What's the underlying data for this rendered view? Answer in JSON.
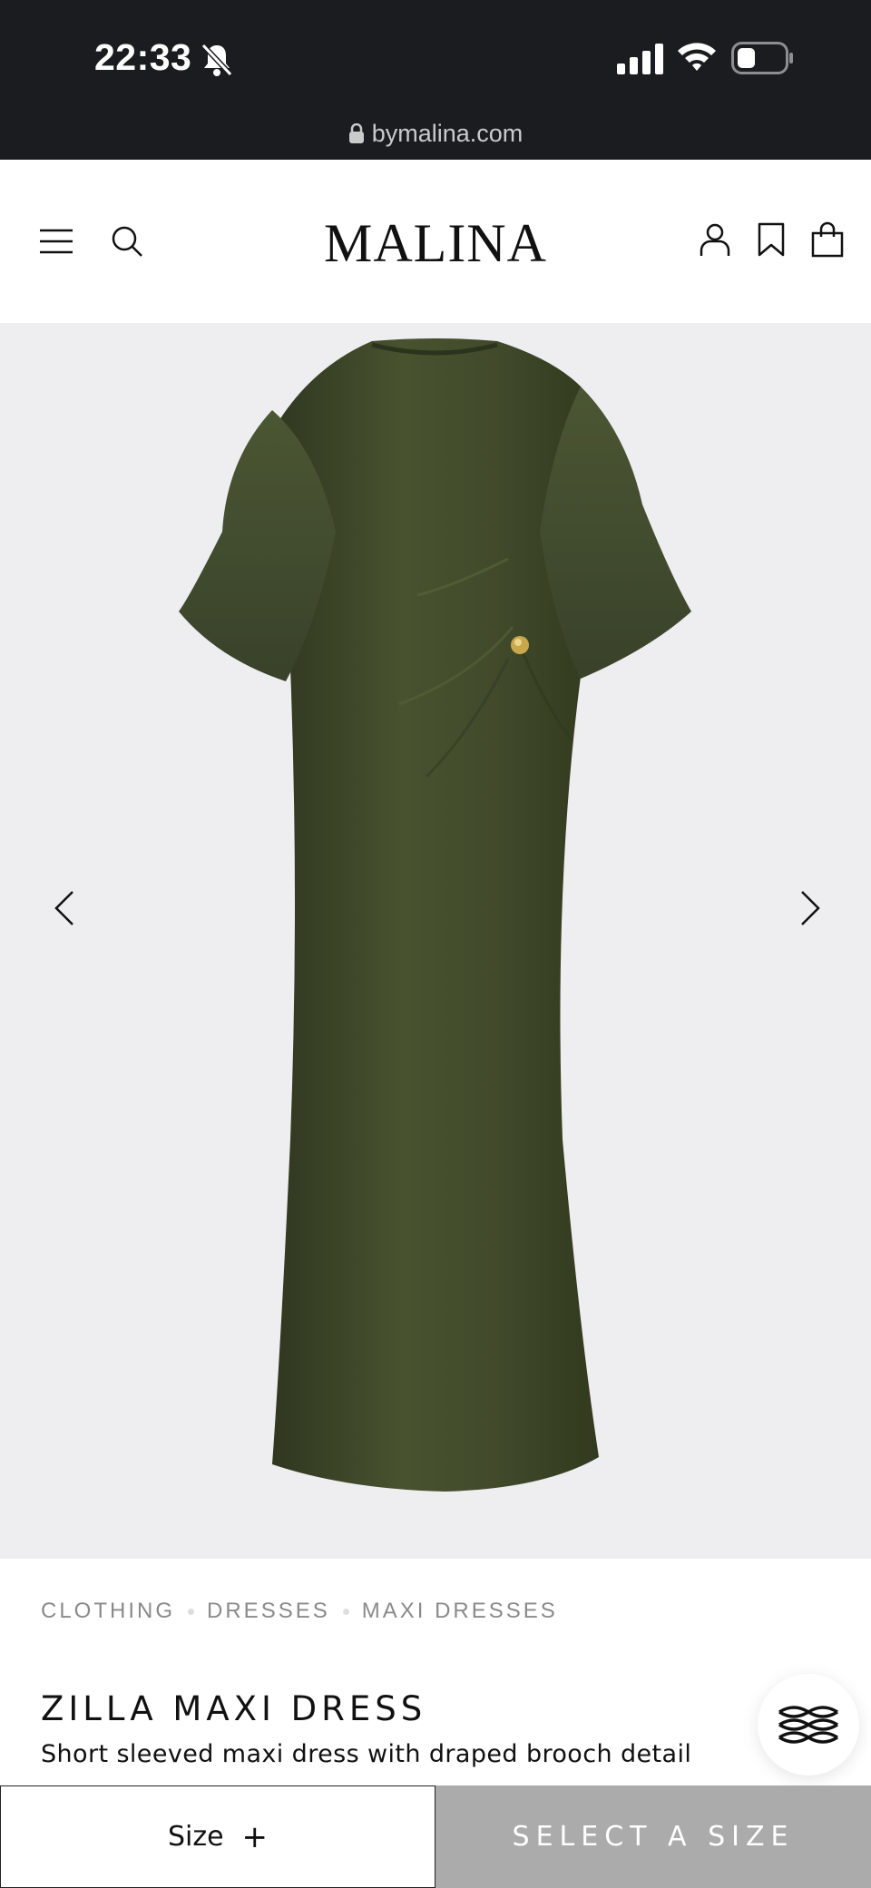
{
  "status_bar": {
    "time": "22:33",
    "icons": [
      "bell-muted-icon",
      "signal-icon",
      "wifi-icon",
      "battery-icon"
    ],
    "url": "bymalina.com"
  },
  "header": {
    "logo": "MALINA",
    "icons": [
      "menu-icon",
      "search-icon",
      "account-icon",
      "bookmark-icon",
      "bag-icon"
    ]
  },
  "gallery": {
    "image_alt": "ZILLA MAXI DRESS",
    "background": "#eeeef1",
    "dress_color": "#414a2b"
  },
  "breadcrumb": [
    "CLOTHING",
    "DRESSES",
    "MAXI DRESSES"
  ],
  "product": {
    "title": "ZILLA MAXI DRESS",
    "description": "Short sleeved maxi dress with draped brooch detail"
  },
  "bottom_bar": {
    "size_label": "Size",
    "size_icon": "+",
    "cta_label": "SELECT A SIZE",
    "cta_color": "#ababab"
  }
}
